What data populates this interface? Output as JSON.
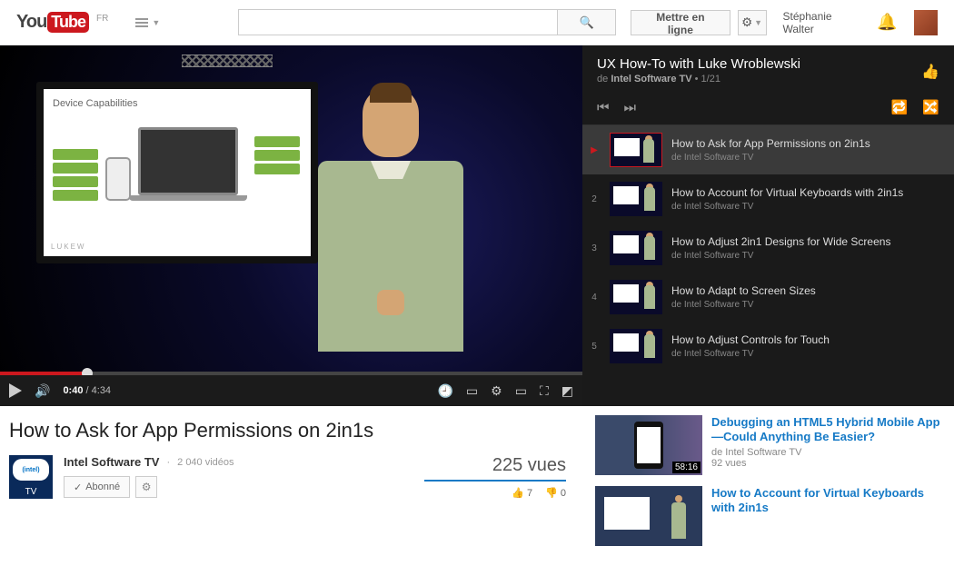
{
  "header": {
    "region": "FR",
    "search_placeholder": "",
    "upload_label": "Mettre en ligne",
    "username": "Stéphanie Walter"
  },
  "player": {
    "presentation_title": "Device Capabilities",
    "presentation_brand": "LUKEW",
    "current_time": "0:40",
    "duration": "4:34"
  },
  "video": {
    "title": "How to Ask for App Permissions on 2in1s",
    "channel_name": "Intel Software TV",
    "channel_videos": "2 040 vidéos",
    "subscribe_label": "Abonné",
    "views_label": "225 vues",
    "likes": "7",
    "dislikes": "0",
    "channel_badge": "TV",
    "channel_badge_top": "(intel)"
  },
  "playlist": {
    "title": "UX How-To with Luke Wroblewski",
    "by_prefix": "de",
    "by": "Intel Software TV",
    "position": "1/21",
    "items": [
      {
        "index": "▶",
        "title": "How to Ask for App Permissions on 2in1s",
        "by": "de Intel Software TV",
        "active": true
      },
      {
        "index": "2",
        "title": "How to Account for Virtual Keyboards with 2in1s",
        "by": "de Intel Software TV"
      },
      {
        "index": "3",
        "title": "How to Adjust 2in1 Designs for Wide Screens",
        "by": "de Intel Software TV"
      },
      {
        "index": "4",
        "title": "How to Adapt to Screen Sizes",
        "by": "de Intel Software TV"
      },
      {
        "index": "5",
        "title": "How to Adjust Controls for Touch",
        "by": "de Intel Software TV"
      }
    ]
  },
  "suggested": [
    {
      "title": "Debugging an HTML5 Hybrid Mobile App—Could Anything Be Easier?",
      "by": "de Intel Software TV",
      "views": "92 vues",
      "duration": "58:16"
    },
    {
      "title": "How to Account for Virtual Keyboards with 2in1s",
      "by": "",
      "views": "",
      "duration": ""
    }
  ]
}
